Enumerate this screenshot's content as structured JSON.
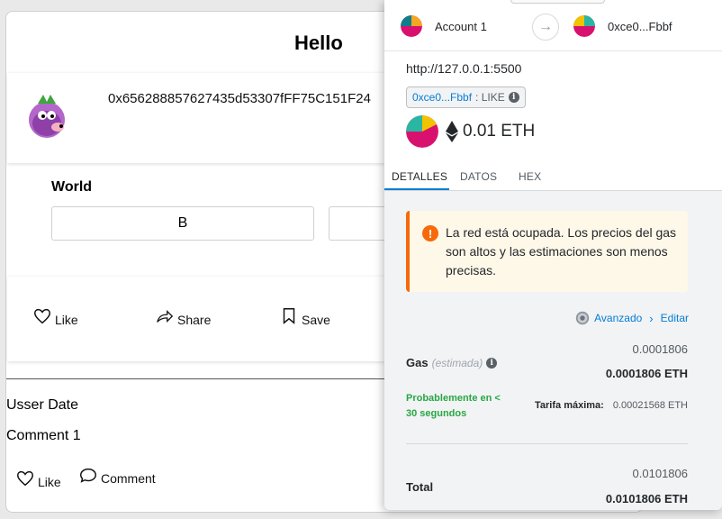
{
  "page": {
    "title": "Hello",
    "address": "0x656288857627435d53307fFF75C151F24",
    "question": "World",
    "options": [
      "B",
      ""
    ],
    "actions": {
      "like": "Like",
      "share": "Share",
      "save": "Save"
    },
    "user_date": "Usser Date",
    "comment_text": "Comment 1",
    "comment_actions": {
      "like": "Like",
      "comment": "Comment"
    }
  },
  "metamask": {
    "from_account": "Account 1",
    "to_account": "0xce0...Fbbf",
    "origin": "http://127.0.0.1:5500",
    "contract_pill": {
      "address": "0xce0...Fbbf",
      "method": ": LIKE"
    },
    "amount": "0.01 ETH",
    "tabs": [
      "DETALLES",
      "DATOS",
      "HEX"
    ],
    "warning": "La red está ocupada. Los precios del gas son altos y las estimaciones son menos precisas.",
    "advanced_label": "Avanzado",
    "edit_label": "Editar",
    "gas": {
      "label": "Gas",
      "estimated": "(estimada)",
      "value": "0.0001806",
      "value_eth": "0.0001806 ETH",
      "likely": "Probablemente en < 30 segundos",
      "max_fee_label": "Tarifa máxima:",
      "max_fee": "0.00021568 ETH"
    },
    "total": {
      "label": "Total",
      "value": "0.0101806",
      "value_eth": "0.0101806 ETH"
    },
    "colors": {
      "accent": "#037dd6",
      "warning": "#f66a0a",
      "success": "#28a745"
    },
    "icons": [
      "arrow-right-icon",
      "info-icon",
      "ethereum-icon",
      "warning-icon",
      "gear-icon",
      "chevron-right-icon"
    ]
  }
}
